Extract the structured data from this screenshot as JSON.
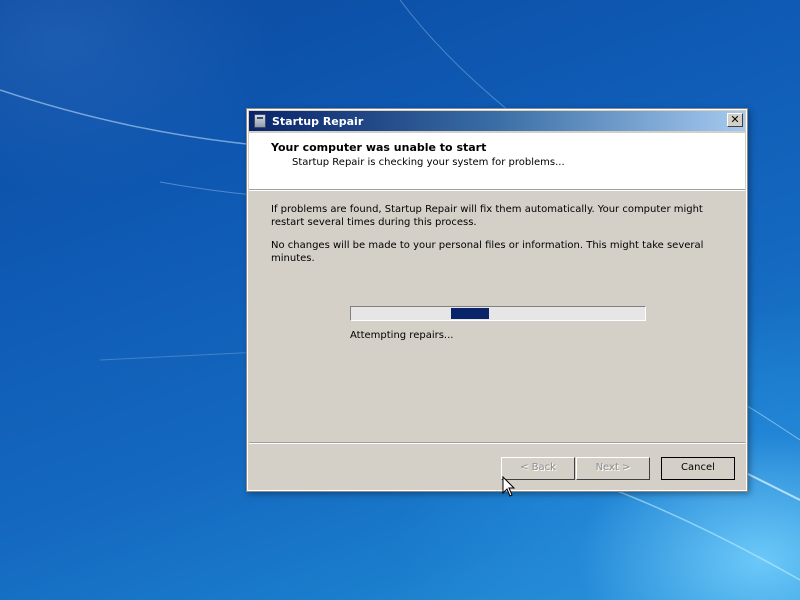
{
  "window": {
    "title": "Startup Repair",
    "close_label": "✕"
  },
  "header": {
    "title": "Your computer was unable to start",
    "subtitle": "Startup Repair is checking your system for problems..."
  },
  "body": {
    "paragraph1": "If problems are found, Startup Repair will fix them automatically. Your computer might restart several times during this process.",
    "paragraph2": "No changes will be made to your personal files or information. This might take several minutes."
  },
  "progress": {
    "status": "Attempting repairs...",
    "marquee_position": 0.34,
    "color": "#0a246a"
  },
  "buttons": {
    "back": "< Back",
    "next": "Next >",
    "cancel": "Cancel"
  },
  "icons": {
    "window_icon": "startup-repair-icon",
    "close": "close-icon",
    "cursor": "mouse-pointer-icon"
  }
}
